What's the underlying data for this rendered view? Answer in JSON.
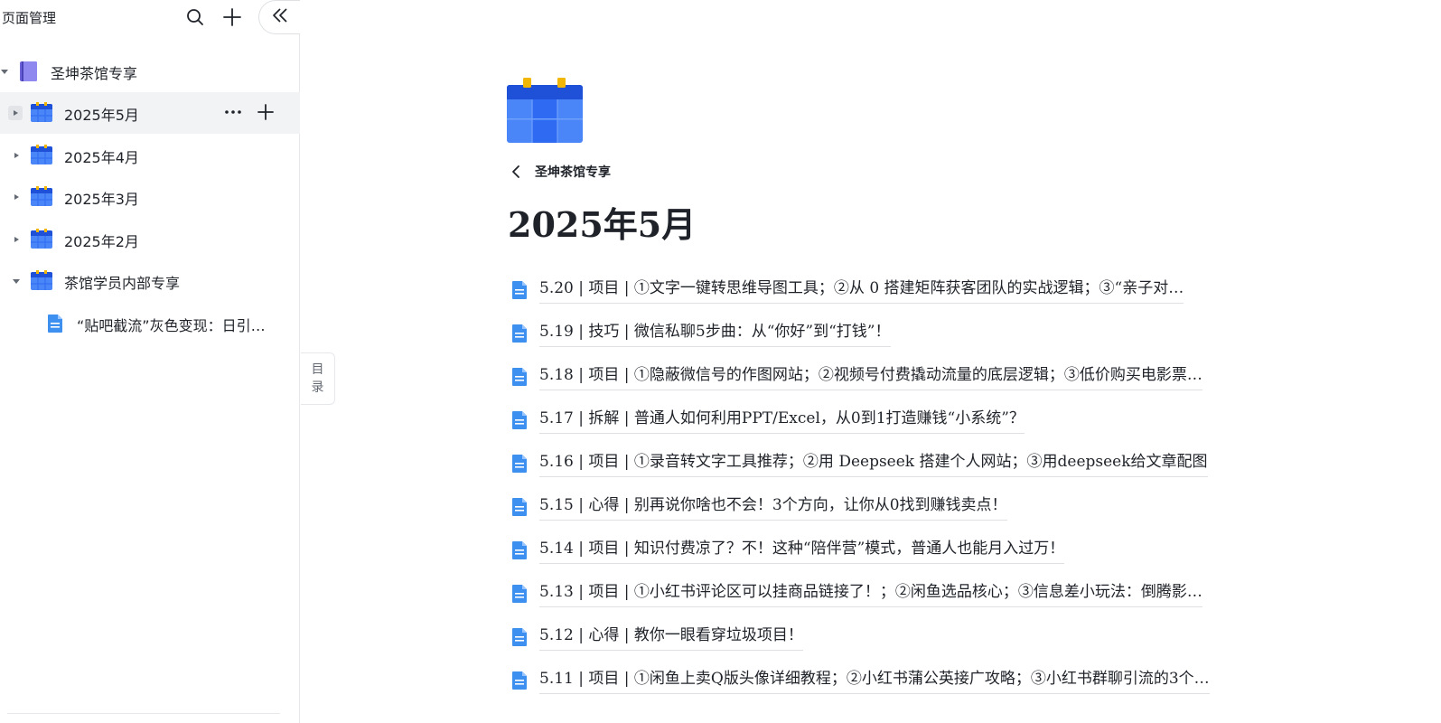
{
  "sidebar": {
    "title": "页面管理",
    "header_icons": [
      "search-icon",
      "plus-icon",
      "collapse-icon"
    ],
    "root": {
      "label": "圣坤茶馆专享",
      "icon": "notebook-icon",
      "expanded": true
    },
    "items": [
      {
        "label": "2025年5月",
        "icon": "calendar-icon",
        "active": true,
        "expanded": false
      },
      {
        "label": "2025年4月",
        "icon": "calendar-icon",
        "active": false,
        "expanded": false
      },
      {
        "label": "2025年3月",
        "icon": "calendar-icon",
        "active": false,
        "expanded": false
      },
      {
        "label": "2025年2月",
        "icon": "calendar-icon",
        "active": false,
        "expanded": false
      },
      {
        "label": "茶馆学员内部专享",
        "icon": "calendar-icon",
        "active": false,
        "expanded": true
      }
    ],
    "child_items": [
      {
        "label": "“贴吧截流”灰色变现：日引…",
        "icon": "doc-icon"
      }
    ],
    "row_actions": [
      "more-icon",
      "plus-icon"
    ]
  },
  "toc_tab": {
    "label_top": "目",
    "label_bottom": "录"
  },
  "main": {
    "back_label": "圣坤茶馆专享",
    "title": "2025年5月",
    "docs": [
      {
        "text": "5.20 | 项目 | ①文字一键转思维导图工具；②从 0 搭建矩阵获客团队的实战逻辑；③“亲子对…"
      },
      {
        "text": "5.19 | 技巧 | 微信私聊5步曲：从“你好”到“打钱”！"
      },
      {
        "text": "5.18 | 项目 | ①隐蔽微信号的作图网站；②视频号付费撬动流量的底层逻辑；③低价购买电影票…"
      },
      {
        "text": "5.17 | 拆解 | 普通人如何利用PPT/Excel，从0到1打造赚钱“小系统”？"
      },
      {
        "text": "5.16 | 项目 | ①录音转文字工具推荐；②用 Deepseek 搭建个人网站；③用deepseek给文章配图"
      },
      {
        "text": "5.15 | 心得 | 别再说你啥也不会！3个方向，让你从0找到赚钱卖点！"
      },
      {
        "text": "5.14 | 项目 | 知识付费凉了？不！这种“陪伴营”模式，普通人也能月入过万！"
      },
      {
        "text": "5.13 | 项目 | ①小红书评论区可以挂商品链接了！；②闲鱼选品核心；③信息差小玩法：倒腾影…"
      },
      {
        "text": "5.12 | 心得 | 教你一眼看穿垃圾项目！"
      },
      {
        "text": "5.11 | 项目 | ①闲鱼上卖Q版头像详细教程；②小红书蒲公英接广攻略；③小红书群聊引流的3个…"
      }
    ]
  },
  "colors": {
    "accent_blue": "#2f6bf2",
    "calendar_top": "#1e50d8",
    "calendar_body": "#4a86f7",
    "calendar_pin": "#f2b705",
    "doc_icon": "#3d8ff0",
    "notebook": "#6c63d9",
    "active_row": "#f2f3f5"
  }
}
